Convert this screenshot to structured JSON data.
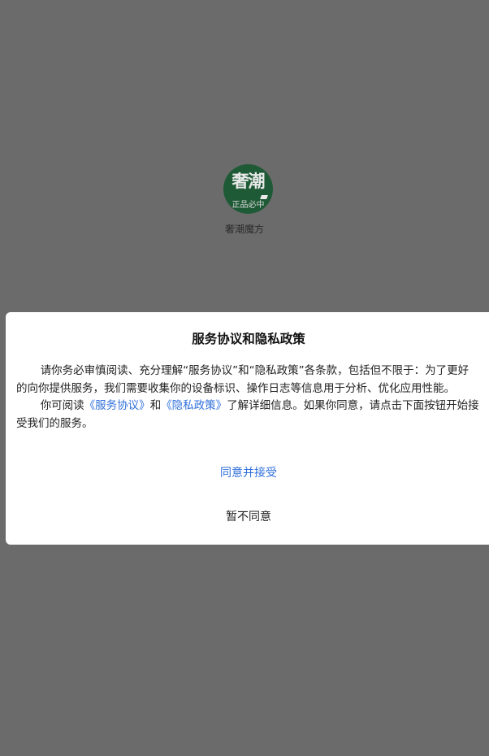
{
  "app": {
    "name": "奢潮魔方",
    "logo_top_text": "奢潮",
    "logo_bottom_text": "正品必中"
  },
  "dialog": {
    "title": "服务协议和隐私政策",
    "paragraph1": "请你务必审慎阅读、充分理解“服务协议”和“隐私政策”各条款，包括但不限于：为了更好的向你提供服务，我们需要收集你的设备标识、操作日志等信息用于分析、优化应用性能。",
    "paragraph2_prefix": "你可阅读",
    "service_agreement_link": "《服务协议》",
    "paragraph2_and": "和",
    "privacy_policy_link": "《隐私政策》",
    "paragraph2_suffix": "了解详细信息。如果你同意，请点击下面按钮开始接受我们的服务。",
    "agree_label": "同意并接受",
    "disagree_label": "暂不同意"
  },
  "colors": {
    "overlay": "#6b6b6b",
    "link": "#2f6fdb",
    "logo_background": "#1f5a36"
  }
}
